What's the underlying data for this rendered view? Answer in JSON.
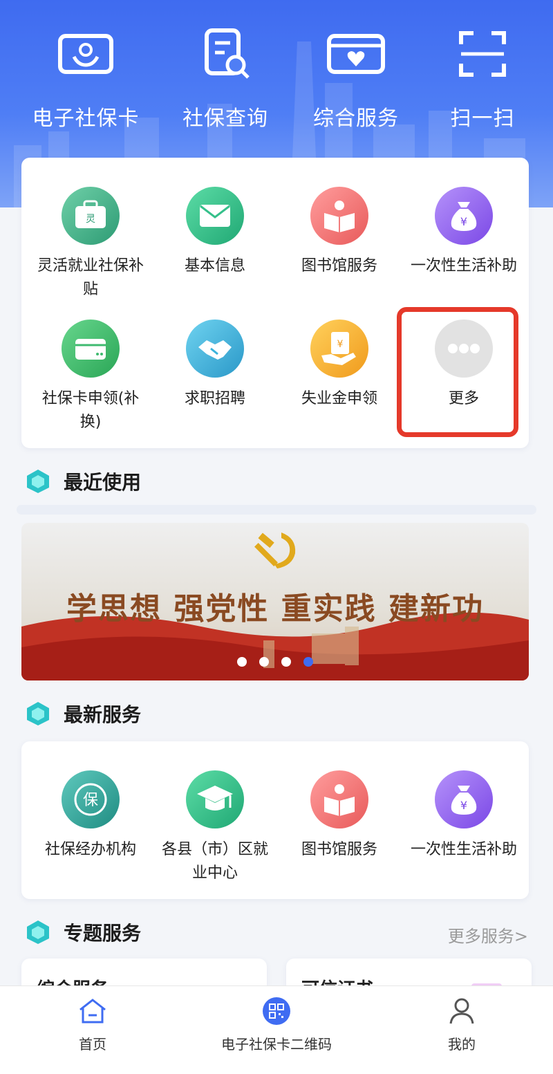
{
  "quick_actions": [
    {
      "label": "电子社保卡",
      "icon": "social-card-icon"
    },
    {
      "label": "社保查询",
      "icon": "document-search-icon"
    },
    {
      "label": "综合服务",
      "icon": "heart-card-icon"
    },
    {
      "label": "扫一扫",
      "icon": "scan-icon"
    }
  ],
  "main_grid": [
    {
      "label": "灵活就业社保补贴",
      "icon": "briefcase-icon",
      "icon_char": "灵",
      "color": "#42b48a"
    },
    {
      "label": "基本信息",
      "icon": "mail-icon",
      "color": "#35c08a"
    },
    {
      "label": "图书馆服务",
      "icon": "book-icon",
      "color": "#f27d7d"
    },
    {
      "label": "一次性生活补助",
      "icon": "money-bag-icon",
      "icon_char": "¥",
      "color": "#9b6cf2"
    },
    {
      "label": "社保卡申领(补换)",
      "icon": "card-icon",
      "color": "#3fba6f"
    },
    {
      "label": "求职招聘",
      "icon": "handshake-icon",
      "color": "#3ab3dc"
    },
    {
      "label": "失业金申领",
      "icon": "money-hand-icon",
      "icon_char": "¥",
      "color": "#f5b431"
    },
    {
      "label": "更多",
      "icon": "more-icon",
      "color": "#dcdcdc"
    }
  ],
  "recent_section": {
    "title": "最近使用"
  },
  "banner": {
    "slogan": "学思想  强党性  重实践  建新功",
    "active_dot": 4,
    "dots": 4
  },
  "new_services": {
    "title": "最新服务",
    "items": [
      {
        "label": "社保经办机构",
        "icon": "bao-icon",
        "icon_char": "保",
        "color": "#2fa59a"
      },
      {
        "label": "各县（市）区就业中心",
        "icon": "graduation-cap-icon",
        "color": "#35c08a"
      },
      {
        "label": "图书馆服务",
        "icon": "book-icon",
        "color": "#f27d7d"
      },
      {
        "label": "一次性生活补助",
        "icon": "money-bag-icon",
        "icon_char": "¥",
        "color": "#9b6cf2"
      }
    ]
  },
  "special_section": {
    "title": "专题服务",
    "more": "更多服务>",
    "cards": [
      "综合服务",
      "可信证书"
    ]
  },
  "tabbar": [
    {
      "label": "首页",
      "icon": "home-icon"
    },
    {
      "label": "电子社保卡二维码",
      "icon": "qr-code-icon"
    },
    {
      "label": "我的",
      "icon": "user-icon"
    }
  ],
  "colors": {
    "primary": "#3f6cf2",
    "highlight": "#e5392a"
  }
}
